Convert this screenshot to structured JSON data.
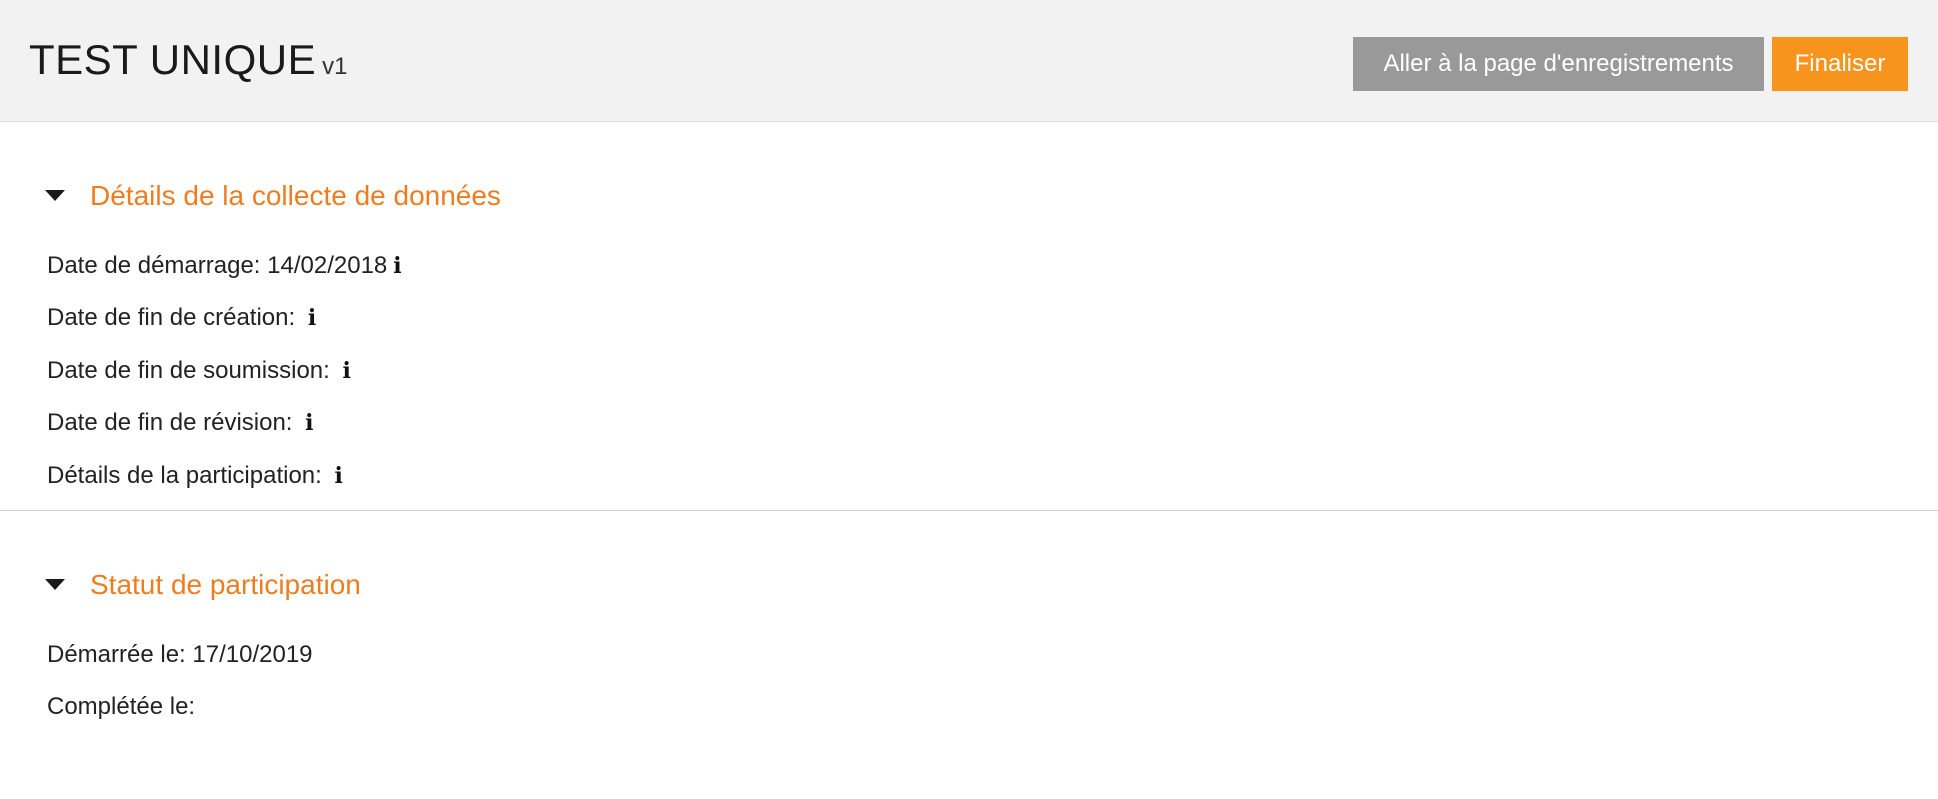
{
  "header": {
    "title": "TEST UNIQUE",
    "version": "v1",
    "records_button_label": "Aller à la page d'enregistrements",
    "finalize_button_label": "Finaliser"
  },
  "collection_details": {
    "title": "Détails de la collecte de données",
    "rows": [
      {
        "label": "Date de démarrage:",
        "value": "14/02/2018"
      },
      {
        "label": "Date de fin de création:",
        "value": ""
      },
      {
        "label": "Date de fin de soumission:",
        "value": ""
      },
      {
        "label": "Date de fin de révision:",
        "value": ""
      },
      {
        "label": "Détails de la participation:",
        "value": ""
      }
    ]
  },
  "participation_status": {
    "title": "Statut de participation",
    "rows": [
      {
        "label": "Démarrée le:",
        "value": "17/10/2019"
      },
      {
        "label": "Complétée le:",
        "value": ""
      }
    ]
  },
  "icons": {
    "info": "info-icon",
    "caret": "caret-down-icon"
  },
  "colors": {
    "accent": "#ee7d22",
    "finalize_button": "#f7941d",
    "secondary_button": "#999999",
    "header_background": "#f2f2f2"
  }
}
